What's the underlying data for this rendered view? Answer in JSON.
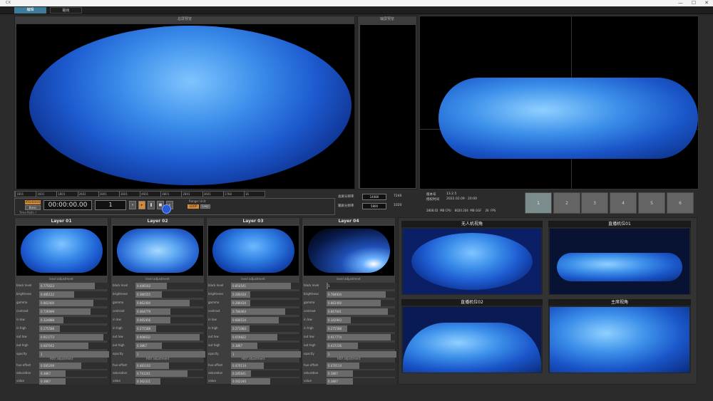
{
  "window": {
    "title": "CX",
    "controls": [
      "—",
      "☐",
      "✕"
    ]
  },
  "tabs": [
    {
      "label": "编辑"
    },
    {
      "label": "输出"
    }
  ],
  "panels": {
    "left_title": "总屏预览",
    "mid_title": "输屏预览"
  },
  "ruler": [
    "1801",
    "1601",
    "1801",
    "2601",
    "2801",
    "3601",
    "4601",
    "4801",
    "2801",
    "3601",
    "1768",
    "16"
  ],
  "transport": {
    "top_label": "ATO:03:01",
    "mode_label": "Basic",
    "timecode": "00:00:00.00",
    "frame": "1",
    "time_path": "Time Path: /",
    "sync_label": "Range: Unit",
    "btn1": "LOOP",
    "btn2": "Loop"
  },
  "resolution": {
    "label1": "总屏分辨率",
    "w1": "14080",
    "h1": "7240",
    "label2": "输屏分辨率",
    "w2": "5800",
    "h2": "1020"
  },
  "info": {
    "ver_label": "版本号",
    "ver": "13.2.5",
    "date_label": "授权时间",
    "date": "2022.02.09 · 20:00",
    "stats": "2808.02  MB CPU    8020.204  MB GGF    26  FPS"
  },
  "scene_buttons": [
    "1",
    "2",
    "3",
    "4",
    "5",
    "6"
  ],
  "layers": [
    {
      "title": "Layer 01",
      "level": {
        "heading": "level adjustment",
        "rows": [
          {
            "label": "black level",
            "value": "0.775623",
            "pct": 0.8
          },
          {
            "label": "brightness",
            "value": "0.485122",
            "pct": 0.5
          },
          {
            "label": "gamma",
            "value": "0.862400",
            "pct": 0.78
          },
          {
            "label": "contrast",
            "value": "0.726999",
            "pct": 0.73
          },
          {
            "label": "in low",
            "value": "0.324888",
            "pct": 0.35
          },
          {
            "label": "in high",
            "value": "0.275588",
            "pct": 0.3
          },
          {
            "label": "out low",
            "value": "0.911773",
            "pct": 0.92
          },
          {
            "label": "out high",
            "value": "0.687042",
            "pct": 0.7
          },
          {
            "label": "opacity",
            "value": "1",
            "pct": 1.0
          }
        ]
      },
      "hsv": {
        "heading": "HSV adjustment",
        "rows": [
          {
            "label": "hue offset",
            "value": "0.585209",
            "pct": 0.6
          },
          {
            "label": "saturation",
            "value": "0.3867",
            "pct": 0.38
          },
          {
            "label": "value",
            "value": "0.3867",
            "pct": 0.38
          }
        ]
      }
    },
    {
      "title": "Layer 02",
      "level": {
        "heading": "level adjustment",
        "rows": [
          {
            "label": "black level",
            "value": "0.446542",
            "pct": 0.45
          },
          {
            "label": "brightness",
            "value": "0.380555",
            "pct": 0.38
          },
          {
            "label": "gamma",
            "value": "0.862400",
            "pct": 0.78
          },
          {
            "label": "contrast",
            "value": "0.464779",
            "pct": 0.5
          },
          {
            "label": "in low",
            "value": "0.065456",
            "pct": 0.5
          },
          {
            "label": "in high",
            "value": "0.275588",
            "pct": 0.3
          },
          {
            "label": "out low",
            "value": "0.908032",
            "pct": 0.92
          },
          {
            "label": "out high",
            "value": "0.3867",
            "pct": 0.38
          },
          {
            "label": "opacity",
            "value": "1",
            "pct": 1.0
          }
        ]
      },
      "hsv": {
        "heading": "HSV adjustment",
        "rows": [
          {
            "label": "hue offset",
            "value": "0.481102",
            "pct": 0.48
          },
          {
            "label": "saturation",
            "value": "0.741241",
            "pct": 0.74
          },
          {
            "label": "value",
            "value": "0.362311",
            "pct": 0.36
          }
        ]
      }
    },
    {
      "title": "Layer 03",
      "level": {
        "heading": "level adjustment",
        "rows": [
          {
            "label": "black level",
            "value": "0.854541",
            "pct": 0.86
          },
          {
            "label": "brightness",
            "value": "0.280434",
            "pct": 0.28
          },
          {
            "label": "gamma",
            "value": "0.280434",
            "pct": 0.28
          },
          {
            "label": "contrast",
            "value": "0.784464",
            "pct": 0.78
          },
          {
            "label": "in low",
            "value": "0.680534",
            "pct": 0.68
          },
          {
            "label": "in high",
            "value": "0.271084",
            "pct": 0.27
          },
          {
            "label": "out low",
            "value": "0.659822",
            "pct": 0.66
          },
          {
            "label": "out high",
            "value": "0.3867",
            "pct": 0.38
          },
          {
            "label": "opacity",
            "value": "1",
            "pct": 1.0
          }
        ]
      },
      "hsv": {
        "heading": "HSV adjustment",
        "rows": [
          {
            "label": "hue offset",
            "value": "0.470114",
            "pct": 0.47
          },
          {
            "label": "saturation",
            "value": "0.285641",
            "pct": 0.29
          },
          {
            "label": "value",
            "value": "0.562240",
            "pct": 0.56
          }
        ]
      }
    },
    {
      "title": "Layer 04",
      "level": {
        "heading": "level adjustment",
        "rows": [
          {
            "label": "black level",
            "value": "1",
            "pct": 0.02
          },
          {
            "label": "brightness",
            "value": "0.784934",
            "pct": 0.85
          },
          {
            "label": "gamma",
            "value": "0.862400",
            "pct": 0.78
          },
          {
            "label": "contrast",
            "value": "0.867641",
            "pct": 0.88
          },
          {
            "label": "in low",
            "value": "0.342943",
            "pct": 0.35
          },
          {
            "label": "in high",
            "value": "0.275588",
            "pct": 0.3
          },
          {
            "label": "out low",
            "value": "0.917774",
            "pct": 0.92
          },
          {
            "label": "out high",
            "value": "0.437236",
            "pct": 0.45
          },
          {
            "label": "opacity",
            "value": "1",
            "pct": 1.0
          }
        ]
      },
      "hsv": {
        "heading": "HSV adjustment",
        "rows": [
          {
            "label": "hue offset",
            "value": "0.470114",
            "pct": 0.47
          },
          {
            "label": "saturation",
            "value": "0.3867",
            "pct": 0.38
          },
          {
            "label": "value",
            "value": "0.3867",
            "pct": 0.38
          }
        ]
      }
    }
  ],
  "views": [
    {
      "label": "无人机视角"
    },
    {
      "label": "直播机位01"
    },
    {
      "label": "直播机位02"
    },
    {
      "label": "主席视角"
    }
  ]
}
